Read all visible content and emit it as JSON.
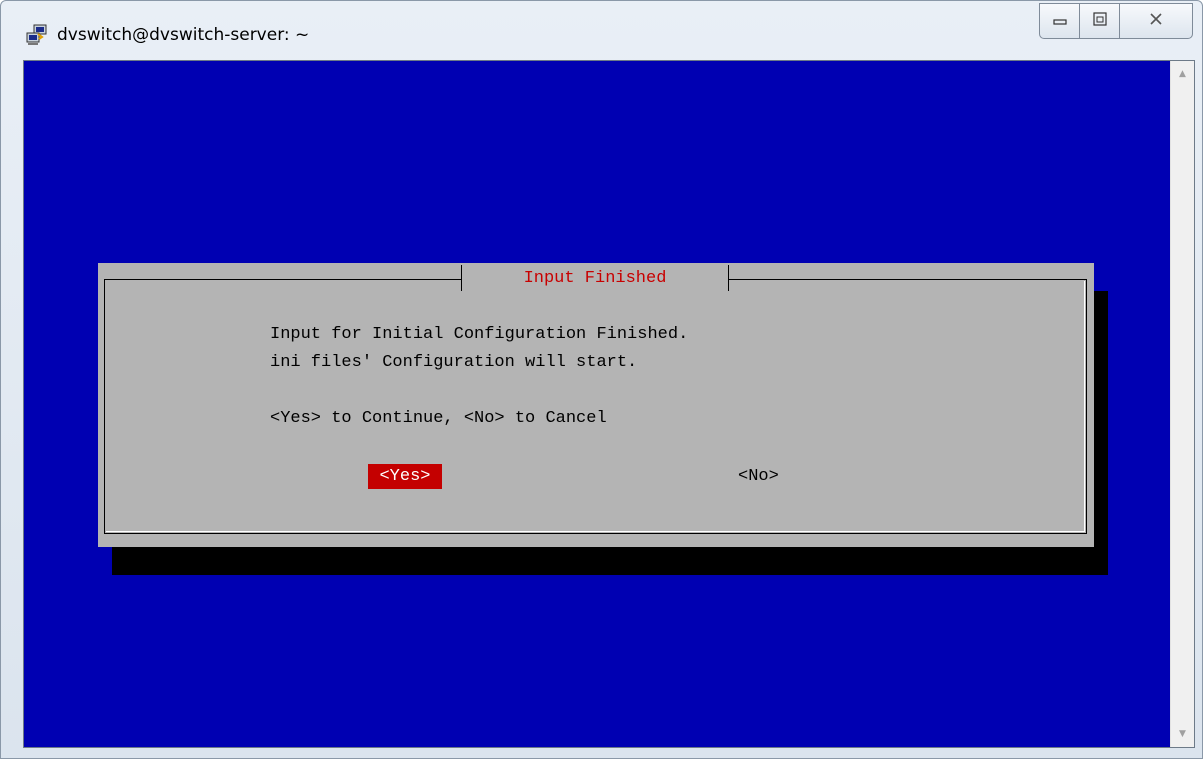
{
  "window": {
    "title": "dvswitch@dvswitch-server: ~",
    "icon": "putty-icon",
    "controls": {
      "minimize": "minimize-icon",
      "maximize": "maximize-icon",
      "close": "close-icon"
    }
  },
  "terminal": {
    "background": "#0000b2"
  },
  "dialog": {
    "title": "Input Finished",
    "lines": [
      "Input for Initial Configuration Finished.",
      "ini files' Configuration will start.",
      "<Yes> to Continue, <No> to Cancel"
    ],
    "buttons": {
      "yes": "<Yes>",
      "no": "<No>"
    },
    "colors": {
      "panel": "#b4b4b4",
      "title": "#c80000",
      "selected": "#c40000"
    }
  }
}
